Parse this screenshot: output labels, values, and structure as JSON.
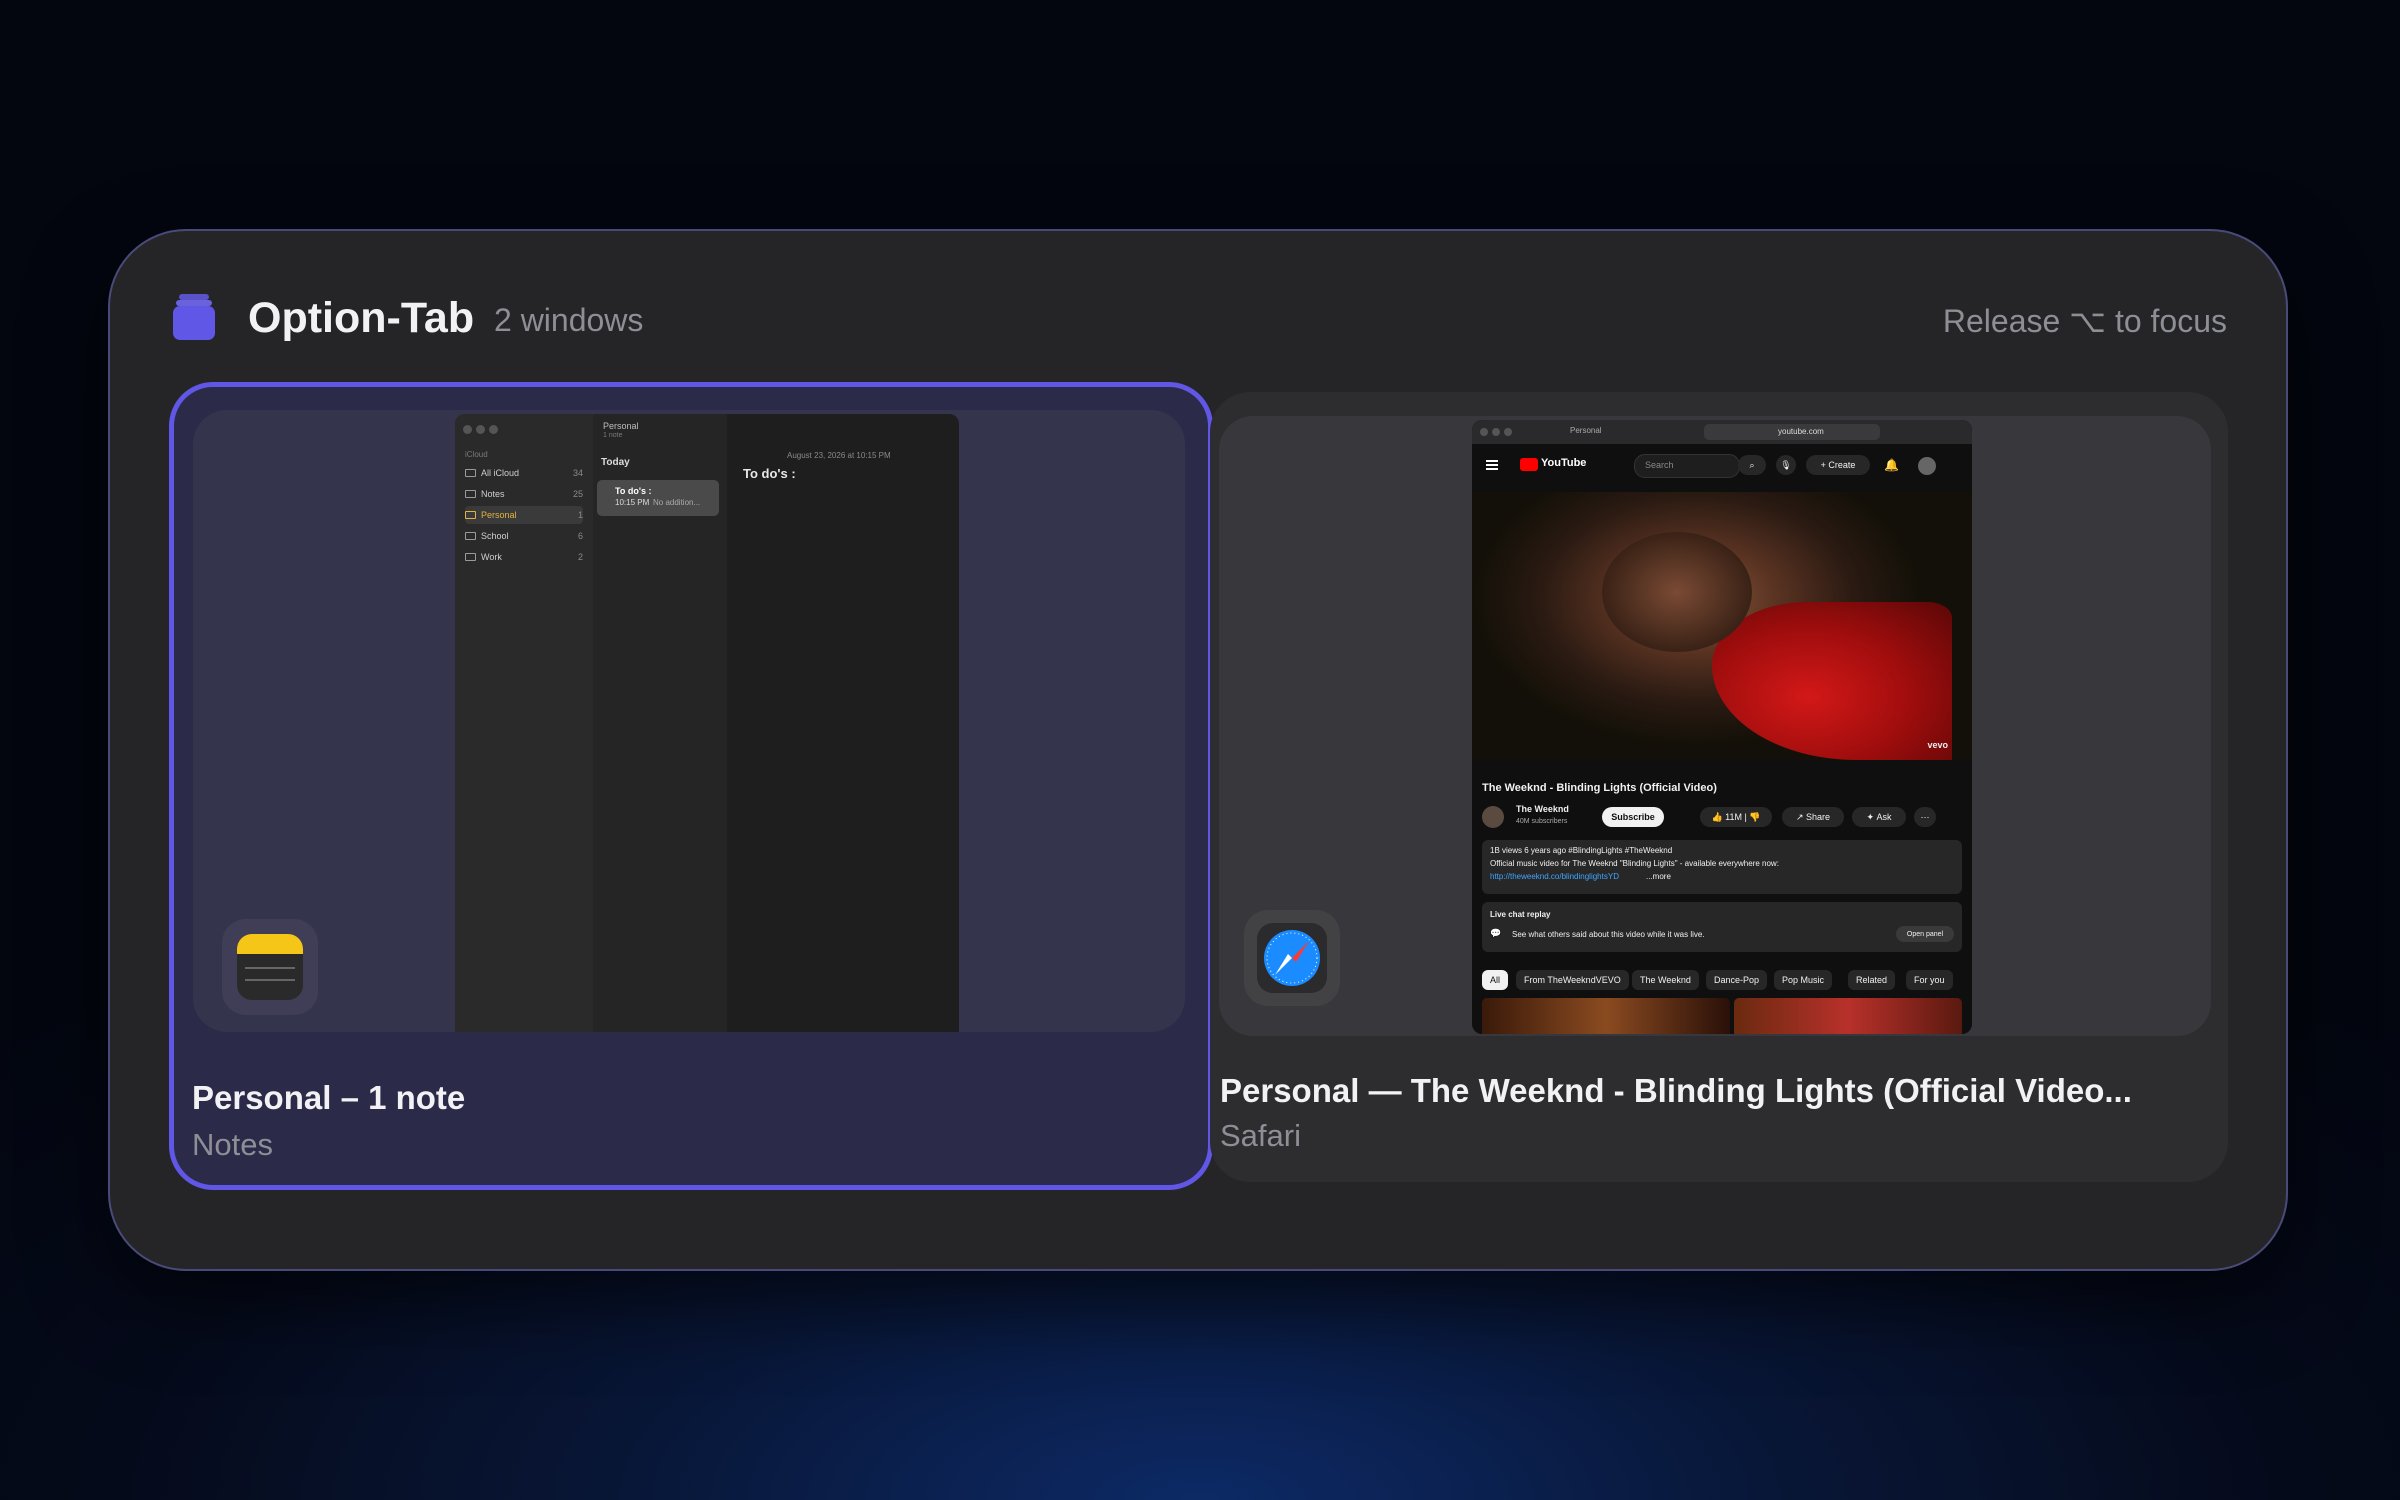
{
  "header": {
    "title": "Option-Tab",
    "window_count": "2 windows",
    "hint": "Release ⌥ to focus",
    "icon": "stack-icon",
    "accent_color": "#6157e6"
  },
  "cards": [
    {
      "title": "Personal – 1 note",
      "app": "Notes",
      "selected": true,
      "icon": "notes-app-icon",
      "preview": {
        "list_header": "Personal",
        "list_subheader": "1 note",
        "section": "Today",
        "note_title": "To do's :",
        "note_meta": "10:15 PM",
        "note_snippet": "No addition...",
        "editor_date": "August 23, 2026 at 10:15 PM",
        "editor_title": "To do's :",
        "sidebar_group": "iCloud",
        "folders": [
          {
            "name": "All iCloud",
            "count": "34"
          },
          {
            "name": "Notes",
            "count": "25"
          },
          {
            "name": "Personal",
            "count": "1"
          },
          {
            "name": "School",
            "count": "6"
          },
          {
            "name": "Work",
            "count": "2"
          }
        ]
      }
    },
    {
      "title": "Personal — The Weeknd - Blinding Lights (Official Video...",
      "app": "Safari",
      "selected": false,
      "icon": "safari-app-icon",
      "preview": {
        "profile": "Personal",
        "url": "youtube.com",
        "site": "YouTube",
        "search_placeholder": "Search",
        "create": "Create",
        "watermark": "vevo",
        "video_title": "The Weeknd - Blinding Lights (Official Video)",
        "channel": "The Weeknd",
        "subscribers": "40M subscribers",
        "subscribe": "Subscribe",
        "likes": "11M",
        "share": "Share",
        "ask": "Ask",
        "desc_stats": "1B views  6 years ago  #BlindingLights #TheWeeknd",
        "desc_line": "Official music video for The Weeknd \"Blinding Lights\" - available everywhere now:",
        "desc_link": "http://theweeknd.co/blindinglightsYD",
        "desc_more": "...more",
        "chat_title": "Live chat replay",
        "chat_text": "See what others said about this video while it was live.",
        "chat_button": "Open panel",
        "chips": [
          "All",
          "From TheWeekndVEVO",
          "The Weeknd",
          "Dance-Pop",
          "Pop Music",
          "Related",
          "For you"
        ]
      }
    }
  ]
}
